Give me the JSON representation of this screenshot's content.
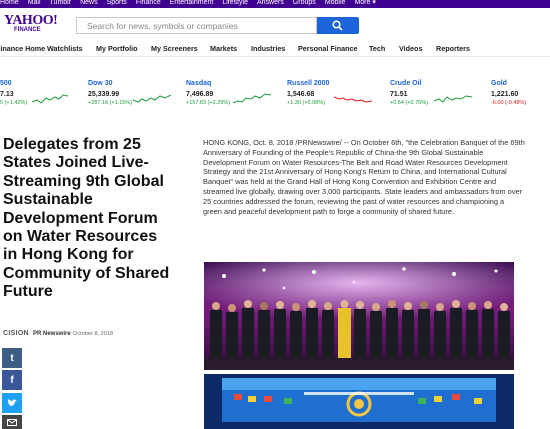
{
  "topbar": {
    "links": [
      "Home",
      "Mail",
      "Tumblr",
      "News",
      "Sports",
      "Finance",
      "Entertainment",
      "Lifestyle",
      "Answers",
      "Groups",
      "Mobile",
      "More ▾"
    ]
  },
  "header": {
    "logo_main": "YAHOO!",
    "logo_sub": "FINANCE",
    "search_placeholder": "Search for news, symbols or companies"
  },
  "nav": [
    "Finance Home",
    "Watchlists",
    "My Portfolio",
    "My Screeners",
    "Markets",
    "Industries",
    "Personal Finance",
    "Tech",
    "Videos",
    "Reporters"
  ],
  "tickers": [
    {
      "name": "500",
      "value": "7.13",
      "change": "5 (+1.42%)",
      "direction": "up"
    },
    {
      "name": "Dow 30",
      "value": "25,339.99",
      "change": "+287.16 (+1.15%)",
      "direction": "up"
    },
    {
      "name": "Nasdaq",
      "value": "7,496.89",
      "change": "+157.83 (+2.29%)",
      "direction": "up"
    },
    {
      "name": "Russell 2000",
      "value": "1,546.68",
      "change": "+1.30 (+0.08%)",
      "direction": "up"
    },
    {
      "name": "Crude Oil",
      "value": "71.51",
      "change": "+0.54 (+0.76%)",
      "direction": "up"
    },
    {
      "name": "Gold",
      "value": "1,221.60",
      "change": "-6.00 (-0.49%)",
      "direction": "down"
    }
  ],
  "colors": {
    "brand": "#400090",
    "search_button": "#1d64d8",
    "up": "#1a9a3a",
    "down": "#e0161d"
  },
  "article": {
    "headline": "Delegates from 25 States Joined Live-Streaming 9th Global Sustainable Development Forum on Water Resources in Hong Kong for Community of Shared Future",
    "source_logo": "CISION",
    "source": "PR Newswire",
    "date": "October 8, 2018",
    "body": "HONG KONG, Oct. 8, 2018 /PRNewswire/ -- On October 6th, \"the Celebration Banquet of the 69th Anniversary of Founding of the People's Republic of China-the 9th Global Sustainable Development Forum on Water Resources-The Belt and Road Water Resources Development Strategy and the 21st Anniversary of Hong Kong's Return to China, and International Cultural Banquet\" was held at the Grand Hall of Hong Kong Convention and Exhibition Centre and streamed live globally, drawing over 3,000 participants. State leaders and ambassadors from over 25 countries addressed the forum, reviewing the past of water resources and championing a green and peaceful development path to forge a community of shared future."
  },
  "share": {
    "tumblr": "t",
    "facebook": "f",
    "twitter": "twitter-icon",
    "mail": "mail-icon"
  }
}
